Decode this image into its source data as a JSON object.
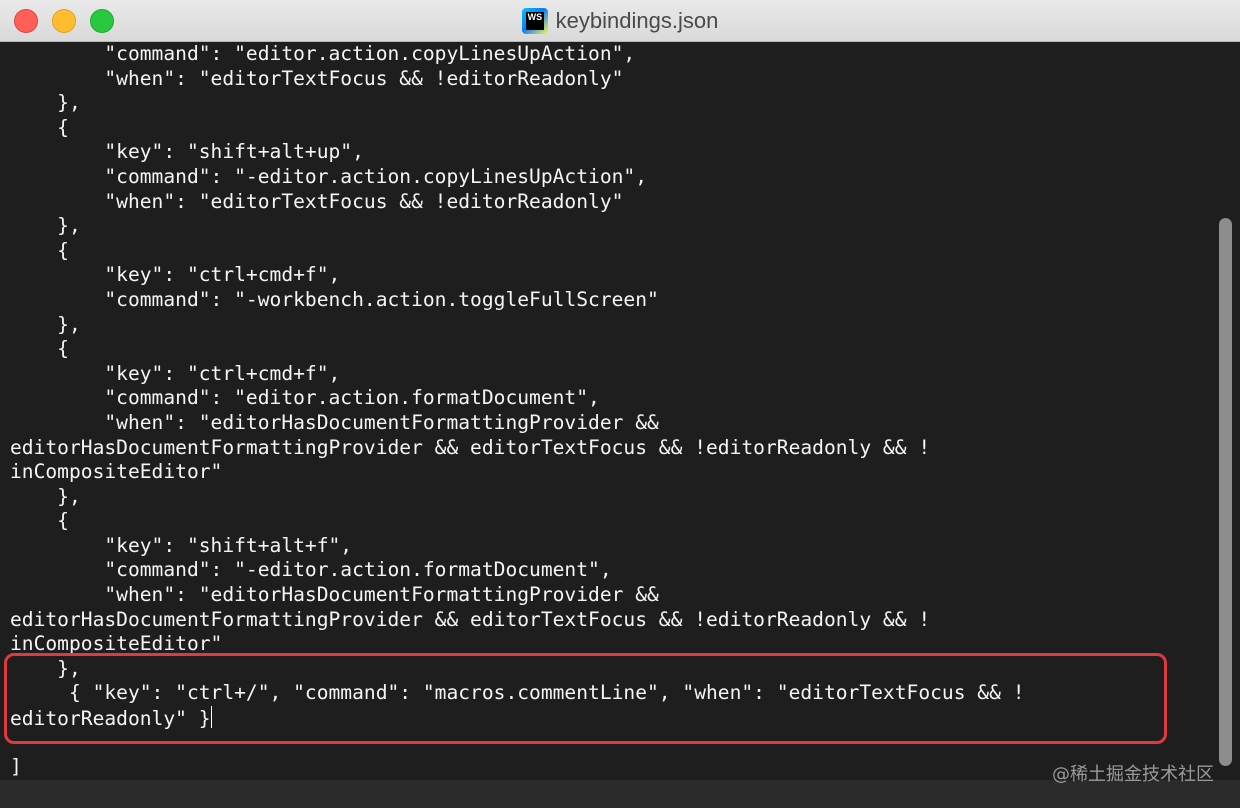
{
  "window": {
    "title": "keybindings.json",
    "app_icon_text": "WS"
  },
  "editor": {
    "lines": [
      "        \"command\": \"editor.action.copyLinesUpAction\",",
      "        \"when\": \"editorTextFocus && !editorReadonly\"",
      "    },",
      "    {",
      "        \"key\": \"shift+alt+up\",",
      "        \"command\": \"-editor.action.copyLinesUpAction\",",
      "        \"when\": \"editorTextFocus && !editorReadonly\"",
      "    },",
      "    {",
      "        \"key\": \"ctrl+cmd+f\",",
      "        \"command\": \"-workbench.action.toggleFullScreen\"",
      "    },",
      "    {",
      "        \"key\": \"ctrl+cmd+f\",",
      "        \"command\": \"editor.action.formatDocument\",",
      "        \"when\": \"editorHasDocumentFormattingProvider &&",
      "editorHasDocumentFormattingProvider && editorTextFocus && !editorReadonly && !",
      "inCompositeEditor\"",
      "    },",
      "    {",
      "        \"key\": \"shift+alt+f\",",
      "        \"command\": \"-editor.action.formatDocument\",",
      "        \"when\": \"editorHasDocumentFormattingProvider &&",
      "editorHasDocumentFormattingProvider && editorTextFocus && !editorReadonly && !",
      "inCompositeEditor\"",
      "    },",
      "     { \"key\": \"ctrl+/\", \"command\": \"macros.commentLine\", \"when\": \"editorTextFocus && !",
      "editorReadonly\" }",
      "",
      "]"
    ],
    "cursor_line": 27
  },
  "watermark": "@稀土掘金技术社区",
  "colors": {
    "background": "#1e1e1e",
    "text": "#f5f5f5",
    "highlight_border": "#e0393e"
  }
}
